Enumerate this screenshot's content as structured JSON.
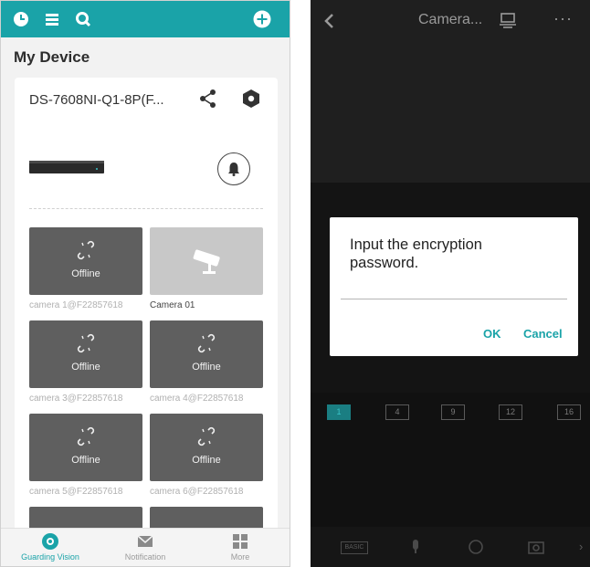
{
  "left": {
    "header": {
      "icons": [
        "clock-menu-icon",
        "list-icon",
        "search-icon",
        "add-icon"
      ],
      "accent_color": "#1aa3a8"
    },
    "title": "My Device",
    "device": {
      "name": "DS-7608NI-Q1-8P(F...",
      "icons": [
        "share-icon",
        "settings-hexagon-icon",
        "alarm-bell-icon"
      ]
    },
    "cameras": [
      {
        "status": "Offline",
        "caption": "camera 1@F22857618"
      },
      {
        "status": "",
        "caption": "Camera 01"
      },
      {
        "status": "Offline",
        "caption": "camera 3@F22857618"
      },
      {
        "status": "Offline",
        "caption": "camera 4@F22857618"
      },
      {
        "status": "Offline",
        "caption": "camera 5@F22857618"
      },
      {
        "status": "Offline",
        "caption": "camera 6@F22857618"
      }
    ],
    "tabs": [
      {
        "label": "Guarding Vision",
        "icon": "guarding-vision-icon",
        "active": true
      },
      {
        "label": "Notification",
        "icon": "mail-icon",
        "active": false
      },
      {
        "label": "More",
        "icon": "grid-icon",
        "active": false
      }
    ]
  },
  "right": {
    "header": {
      "title": "Camera...",
      "icons": [
        "back-icon",
        "layout-icon",
        "more-icon"
      ],
      "more": "···"
    },
    "dialog": {
      "message": "Input the encryption password.",
      "input_value": "",
      "ok_label": "OK",
      "cancel_label": "Cancel"
    },
    "split_options": [
      "1",
      "4",
      "9",
      "12",
      "16"
    ],
    "selected_split": "1",
    "bottom": {
      "basic_label": "BASIC",
      "icons": [
        "microphone-icon",
        "ptz-icon",
        "snapshot-icon",
        "next-icon"
      ],
      "next": "›"
    }
  }
}
